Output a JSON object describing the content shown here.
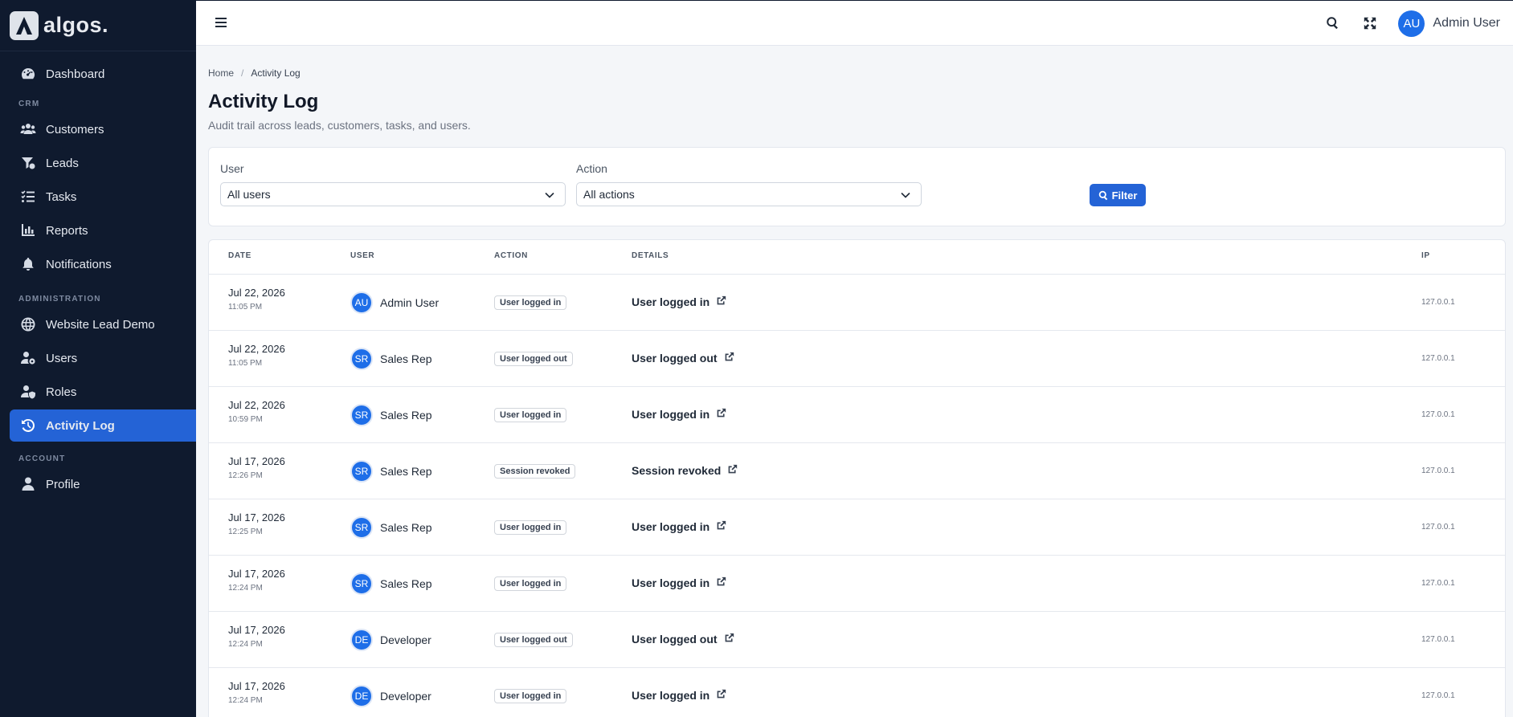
{
  "brand": {
    "name": "algos."
  },
  "sidebar": {
    "items": [
      {
        "label": "Dashboard",
        "icon": "dashboard-icon",
        "active": false
      },
      {
        "section": "CRM"
      },
      {
        "label": "Customers",
        "icon": "users-icon",
        "active": false
      },
      {
        "label": "Leads",
        "icon": "funnel-icon",
        "active": false
      },
      {
        "label": "Tasks",
        "icon": "tasks-icon",
        "active": false
      },
      {
        "label": "Reports",
        "icon": "chart-icon",
        "active": false
      },
      {
        "label": "Notifications",
        "icon": "bell-icon",
        "active": false
      },
      {
        "section": "ADMINISTRATION"
      },
      {
        "label": "Website Lead Demo",
        "icon": "globe-icon",
        "active": false
      },
      {
        "label": "Users",
        "icon": "user-gear-icon",
        "active": false
      },
      {
        "label": "Roles",
        "icon": "user-shield-icon",
        "active": false
      },
      {
        "label": "Activity Log",
        "icon": "history-icon",
        "active": true
      },
      {
        "section": "ACCOUNT"
      },
      {
        "label": "Profile",
        "icon": "user-icon",
        "active": false
      }
    ]
  },
  "topbar": {
    "user_initials": "AU",
    "user_name": "Admin User",
    "icons": [
      "menu-icon",
      "search-icon",
      "fullscreen-icon"
    ]
  },
  "breadcrumb": {
    "home": "Home",
    "separator": "/",
    "current": "Activity Log"
  },
  "page": {
    "title": "Activity Log",
    "subtitle": "Audit trail across leads, customers, tasks, and users."
  },
  "filters": {
    "user_label": "User",
    "user_value": "All users",
    "action_label": "Action",
    "action_value": "All actions",
    "button_label": "Filter"
  },
  "table": {
    "columns": [
      "DATE",
      "USER",
      "ACTION",
      "DETAILS",
      "IP"
    ],
    "rows": [
      {
        "date": "Jul 22, 2026",
        "time": "11:05 PM",
        "initials": "AU",
        "user": "Admin User",
        "action": "User logged in",
        "details": "User logged in",
        "ip": "127.0.0.1"
      },
      {
        "date": "Jul 22, 2026",
        "time": "11:05 PM",
        "initials": "SR",
        "user": "Sales Rep",
        "action": "User logged out",
        "details": "User logged out",
        "ip": "127.0.0.1"
      },
      {
        "date": "Jul 22, 2026",
        "time": "10:59 PM",
        "initials": "SR",
        "user": "Sales Rep",
        "action": "User logged in",
        "details": "User logged in",
        "ip": "127.0.0.1"
      },
      {
        "date": "Jul 17, 2026",
        "time": "12:26 PM",
        "initials": "SR",
        "user": "Sales Rep",
        "action": "Session revoked",
        "details": "Session revoked",
        "ip": "127.0.0.1"
      },
      {
        "date": "Jul 17, 2026",
        "time": "12:25 PM",
        "initials": "SR",
        "user": "Sales Rep",
        "action": "User logged in",
        "details": "User logged in",
        "ip": "127.0.0.1"
      },
      {
        "date": "Jul 17, 2026",
        "time": "12:24 PM",
        "initials": "SR",
        "user": "Sales Rep",
        "action": "User logged in",
        "details": "User logged in",
        "ip": "127.0.0.1"
      },
      {
        "date": "Jul 17, 2026",
        "time": "12:24 PM",
        "initials": "DE",
        "user": "Developer",
        "action": "User logged out",
        "details": "User logged out",
        "ip": "127.0.0.1"
      },
      {
        "date": "Jul 17, 2026",
        "time": "12:24 PM",
        "initials": "DE",
        "user": "Developer",
        "action": "User logged in",
        "details": "User logged in",
        "ip": "127.0.0.1"
      }
    ]
  },
  "colors": {
    "sidebar_bg": "#0f1a2e",
    "accent": "#2463d6",
    "avatar": "#1e6ee8"
  }
}
